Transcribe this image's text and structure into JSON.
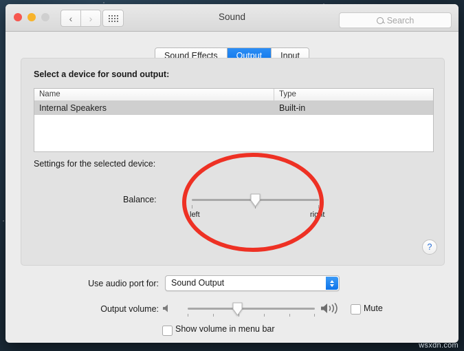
{
  "window": {
    "title": "Sound",
    "traffic_lights": [
      "close",
      "minimize",
      "zoom"
    ],
    "nav_back": "‹",
    "nav_forward": "›",
    "grid_icon": "grid-apps-icon"
  },
  "search": {
    "placeholder": "Search",
    "icon": "search-icon"
  },
  "tabs": [
    {
      "label": "Sound Effects",
      "active": false
    },
    {
      "label": "Output",
      "active": true
    },
    {
      "label": "Input",
      "active": false
    }
  ],
  "panel": {
    "device_prompt": "Select a device for sound output:",
    "settings_prompt": "Settings for the selected device:",
    "help_label": "?"
  },
  "table": {
    "columns": [
      "Name",
      "Type"
    ],
    "rows": [
      {
        "name": "Internal Speakers",
        "type": "Built-in",
        "selected": true
      }
    ]
  },
  "balance": {
    "label": "Balance:",
    "min_label": "left",
    "max_label": "right",
    "value_percent": 50
  },
  "audio_port": {
    "label": "Use audio port for:",
    "selected": "Sound Output",
    "options": [
      "Sound Output"
    ]
  },
  "output_volume": {
    "label": "Output volume:",
    "value_percent": 39,
    "low_icon": "speaker-low-icon",
    "high_icon": "speaker-high-icon",
    "mute_label": "Mute",
    "mute_checked": false
  },
  "show_volume": {
    "label": "Show volume in menu bar",
    "checked": false
  },
  "annotation": {
    "shape": "ellipse",
    "color": "#ee3124"
  },
  "watermark": "wsxdn.com",
  "colors": {
    "accent_blue": "#0b72e8",
    "annotation_red": "#ee3124",
    "window_bg": "#ececec",
    "panel_bg": "#e2e2e2",
    "selected_row": "#cfcfcf"
  }
}
